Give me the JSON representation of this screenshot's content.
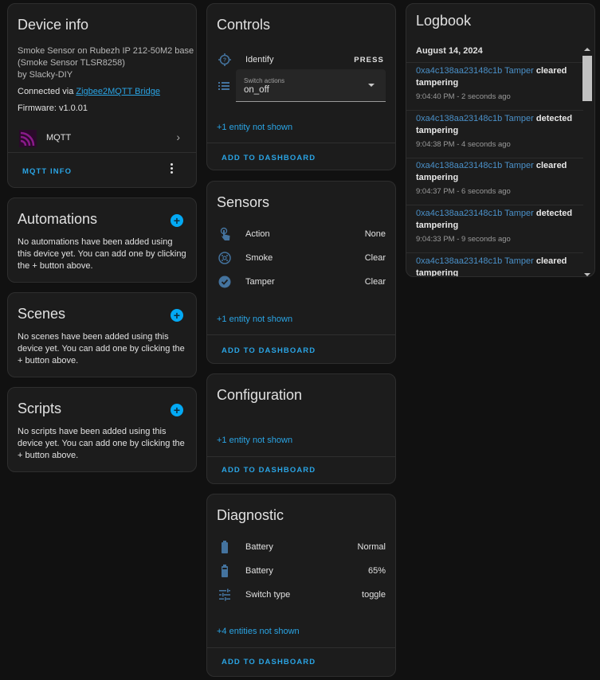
{
  "device_info": {
    "title": "Device info",
    "model_line1": "Smoke Sensor on Rubezh IP 212-50M2 base",
    "model_line2": "(Smoke Sensor TLSR8258)",
    "manufacturer": "by Slacky-DIY",
    "connected_via_label": "Connected via",
    "connected_via_link": "Zigbee2MQTT Bridge",
    "firmware": "Firmware: v1.0.01",
    "integration": {
      "name": "MQTT",
      "icon": "mqtt-icon",
      "color": "#660066"
    },
    "mqtt_info_button": "MQTT INFO"
  },
  "automations": {
    "title": "Automations",
    "empty_text": "No automations have been added using this device yet. You can add one by clicking the + button above."
  },
  "scenes": {
    "title": "Scenes",
    "empty_text": "No scenes have been added using this device yet. You can add one by clicking the + button above."
  },
  "scripts": {
    "title": "Scripts",
    "empty_text": "No scripts have been added using this device yet. You can add one by clicking the + button above."
  },
  "controls": {
    "title": "Controls",
    "identify": {
      "name": "Identify",
      "icon": "identify-icon",
      "action": "PRESS"
    },
    "switch_actions": {
      "label": "Switch actions",
      "value": "on_off",
      "icon": "list-icon"
    },
    "not_shown": "+1 entity not shown",
    "add_to_dashboard": "ADD TO DASHBOARD"
  },
  "sensors": {
    "title": "Sensors",
    "rows": [
      {
        "name": "Action",
        "value": "None",
        "icon": "gesture-tap-icon"
      },
      {
        "name": "Smoke",
        "value": "Clear",
        "icon": "smoke-detector-icon"
      },
      {
        "name": "Tamper",
        "value": "Clear",
        "icon": "check-circle-icon"
      }
    ],
    "not_shown": "+1 entity not shown",
    "add_to_dashboard": "ADD TO DASHBOARD"
  },
  "configuration": {
    "title": "Configuration",
    "not_shown": "+1 entity not shown",
    "add_to_dashboard": "ADD TO DASHBOARD"
  },
  "diagnostic": {
    "title": "Diagnostic",
    "rows": [
      {
        "name": "Battery",
        "value": "Normal",
        "icon": "battery-icon"
      },
      {
        "name": "Battery",
        "value": "65%",
        "icon": "battery-60-icon"
      },
      {
        "name": "Switch type",
        "value": "toggle",
        "icon": "tune-icon"
      }
    ],
    "not_shown": "+4 entities not shown",
    "add_to_dashboard": "ADD TO DASHBOARD"
  },
  "logbook": {
    "title": "Logbook",
    "date": "August 14, 2024",
    "entries": [
      {
        "entity": "0xa4c138aa23148c1b Tamper",
        "action": "cleared",
        "rest": "tampering",
        "time": "9:04:40 PM - 2 seconds ago"
      },
      {
        "entity": "0xa4c138aa23148c1b Tamper",
        "action": "detected",
        "rest": "tampering",
        "time": "9:04:38 PM - 4 seconds ago"
      },
      {
        "entity": "0xa4c138aa23148c1b Tamper",
        "action": "cleared",
        "rest": "tampering",
        "time": "9:04:37 PM - 6 seconds ago"
      },
      {
        "entity": "0xa4c138aa23148c1b Tamper",
        "action": "detected",
        "rest": "tampering",
        "time": "9:04:33 PM - 9 seconds ago"
      },
      {
        "entity": "0xa4c138aa23148c1b Tamper",
        "action": "cleared",
        "rest": "tampering",
        "time": ""
      }
    ]
  },
  "colors": {
    "accent": "#03a9f4",
    "link": "#2aa4e4",
    "state_icon": "#44739e",
    "card_bg": "#1c1c1c",
    "page_bg": "#111111"
  }
}
